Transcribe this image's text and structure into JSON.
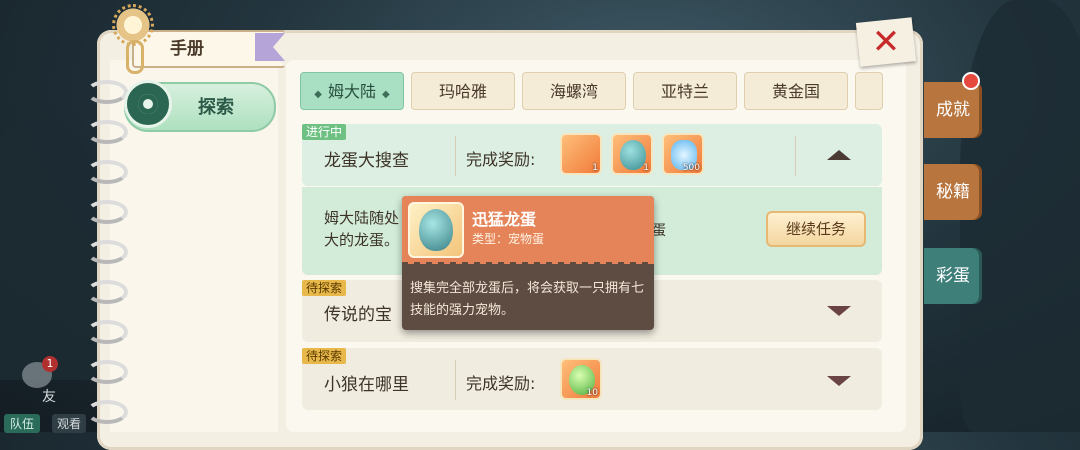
{
  "book": {
    "title": "手册"
  },
  "sidebar": {
    "items": [
      {
        "label": "探索",
        "icon": "explore-icon"
      }
    ]
  },
  "tabs": [
    {
      "label": "姆大陆",
      "active": true
    },
    {
      "label": "玛哈雅",
      "active": false
    },
    {
      "label": "海螺湾",
      "active": false
    },
    {
      "label": "亚特兰",
      "active": false
    },
    {
      "label": "黄金国",
      "active": false
    }
  ],
  "quests": [
    {
      "status": "进行中",
      "title": "龙蛋大搜查",
      "reward_label": "完成奖励:",
      "rewards": [
        {
          "icon": "card-icon",
          "count": "1"
        },
        {
          "icon": "dragon-egg-icon",
          "count": "1"
        },
        {
          "icon": "crystal-icon",
          "count": "500"
        }
      ],
      "detail_text": "姆大陆随处\n大的龙蛋。",
      "detail_tail": "蛋",
      "action_label": "继续任务",
      "expanded": true
    },
    {
      "status": "待探索",
      "title": "传说的宝",
      "expanded": false
    },
    {
      "status": "待探索",
      "title": "小狼在哪里",
      "reward_label": "完成奖励:",
      "rewards": [
        {
          "icon": "green-orb-icon",
          "count": "10"
        }
      ],
      "expanded": false
    }
  ],
  "tooltip": {
    "name": "迅猛龙蛋",
    "type": "类型：宠物蛋",
    "description": "搜集完全部龙蛋后，将会获取一只拥有七技能的强力宠物。"
  },
  "right_tabs": [
    {
      "label": "成就",
      "active": false,
      "has_dot": true
    },
    {
      "label": "秘籍",
      "active": false
    },
    {
      "label": "彩蛋",
      "active": true
    }
  ],
  "hud": {
    "friend_badge": "1",
    "friend_label": "友",
    "team_label": "队伍",
    "watch_label": "观看"
  },
  "colors": {
    "active_tab": "#a9dfc3",
    "in_progress_tag": "#6ec083",
    "pending_tag": "#e8b84a",
    "tooltip_header": "#e58459",
    "right_tab": "#b8753e",
    "right_tab_active": "#3f7f7a"
  }
}
